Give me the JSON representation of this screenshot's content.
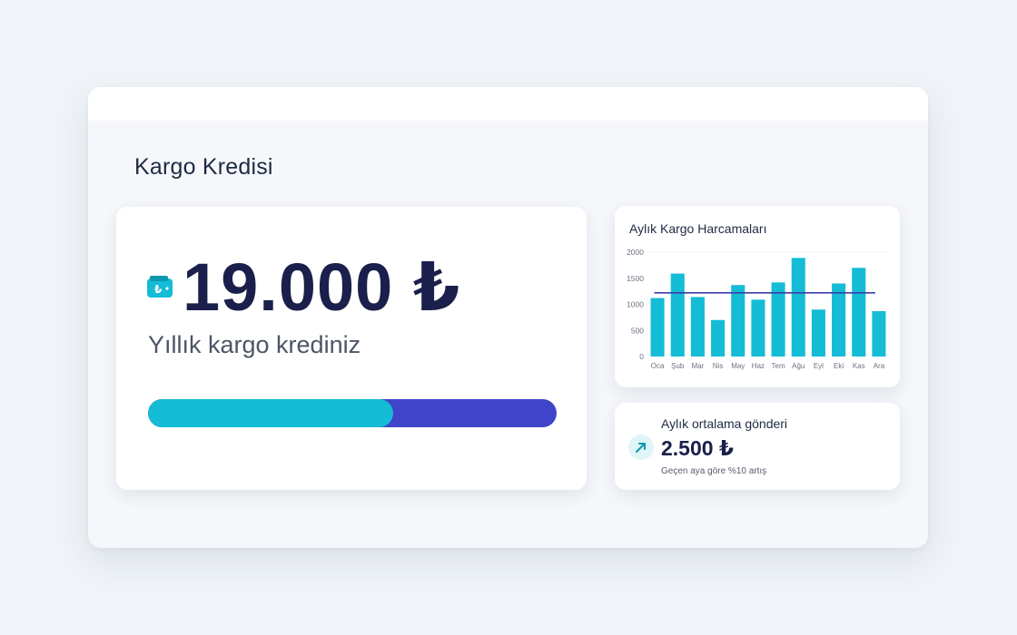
{
  "page": {
    "title": "Kargo Kredisi"
  },
  "credit": {
    "amount": "19.000 ₺",
    "subtitle": "Yıllık kargo krediniz",
    "progress_fraction": 0.6,
    "wallet_icon": "wallet-lira-icon"
  },
  "chart": {
    "title": "Aylık Kargo Harcamaları"
  },
  "chart_data": {
    "type": "bar",
    "title": "Aylık Kargo Harcamaları",
    "categories": [
      "Oca",
      "Şub",
      "Mar",
      "Nis",
      "May",
      "Haz",
      "Tem",
      "Ağu",
      "Eyl",
      "Eki",
      "Kas",
      "Ara"
    ],
    "values": [
      1120,
      1590,
      1140,
      700,
      1370,
      1090,
      1420,
      1890,
      900,
      1400,
      1700,
      870
    ],
    "average_line": 1220,
    "ylim": [
      0,
      2000
    ],
    "yticks": [
      "0",
      "500",
      "1000",
      "1500",
      "2000"
    ],
    "grid": false,
    "bar_color": "#14bcd6",
    "line_color": "#3b3fa8"
  },
  "stat": {
    "label": "Aylık ortalama gönderi",
    "value": "2.500 ₺",
    "note": "Geçen aya göre %10 artış",
    "icon": "trend-up-arrow-icon"
  },
  "colors": {
    "accent": "#14bcd6",
    "secondary": "#4044c9",
    "text_dark": "#1b1f4b"
  }
}
